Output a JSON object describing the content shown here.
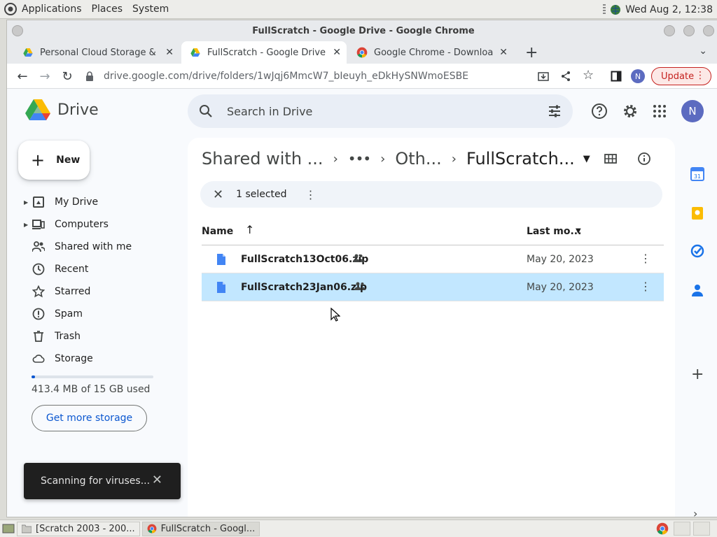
{
  "os_panel": {
    "menus": [
      "Applications",
      "Places",
      "System"
    ],
    "clock": "Wed Aug  2, 12:38"
  },
  "window": {
    "title": "FullScratch - Google Drive - Google Chrome"
  },
  "tabs": [
    {
      "label": "Personal Cloud Storage & File",
      "icon": "drive-icon",
      "active": false
    },
    {
      "label": "FullScratch - Google Drive",
      "icon": "drive-icon",
      "active": true
    },
    {
      "label": "Google Chrome - Download th",
      "icon": "chrome-icon",
      "active": false
    }
  ],
  "toolbar": {
    "url": "drive.google.com/drive/folders/1wJqj6MmcW7_bIeuyh_eDkHySNWmoESBE",
    "profile_initial": "N",
    "update_label": "Update"
  },
  "drive": {
    "product_name": "Drive",
    "search_placeholder": "Search in Drive",
    "avatar_initial": "N",
    "new_label": "New",
    "nav": [
      {
        "label": "My Drive",
        "icon": "my-drive-icon",
        "caret": true
      },
      {
        "label": "Computers",
        "icon": "computers-icon",
        "caret": true
      },
      {
        "label": "Shared with me",
        "icon": "people-icon",
        "caret": false
      },
      {
        "label": "Recent",
        "icon": "clock-icon",
        "caret": false
      },
      {
        "label": "Starred",
        "icon": "star-icon",
        "caret": false
      },
      {
        "label": "Spam",
        "icon": "spam-icon",
        "caret": false
      },
      {
        "label": "Trash",
        "icon": "trash-icon",
        "caret": false
      },
      {
        "label": "Storage",
        "icon": "cloud-icon",
        "caret": false
      }
    ],
    "storage_text": "413.4 MB of 15 GB used",
    "storage_fraction": 0.027,
    "get_storage_label": "Get more storage",
    "breadcrumb": {
      "first": "Shared with ...",
      "ellipsis": "•••",
      "second": "Oth...",
      "current": "FullScratch..."
    },
    "selection": {
      "text": "1 selected"
    },
    "columns": {
      "name": "Name",
      "modified": "Last mo..."
    },
    "files": [
      {
        "name": "FullScratch13Oct06.zip",
        "modified": "May 20, 2023",
        "selected": false
      },
      {
        "name": "FullScratch23Jan06.zip",
        "modified": "May 20, 2023",
        "selected": true
      }
    ],
    "toast": {
      "text": "Scanning for viruses..."
    }
  },
  "taskbar": {
    "items": [
      {
        "label": "[Scratch 2003 - 200...",
        "active": false
      },
      {
        "label": "FullScratch - Googl...",
        "active": true
      }
    ]
  },
  "colors": {
    "accent": "#0b57d0",
    "selected_row": "#c2e7ff",
    "update_red": "#c5221f"
  }
}
